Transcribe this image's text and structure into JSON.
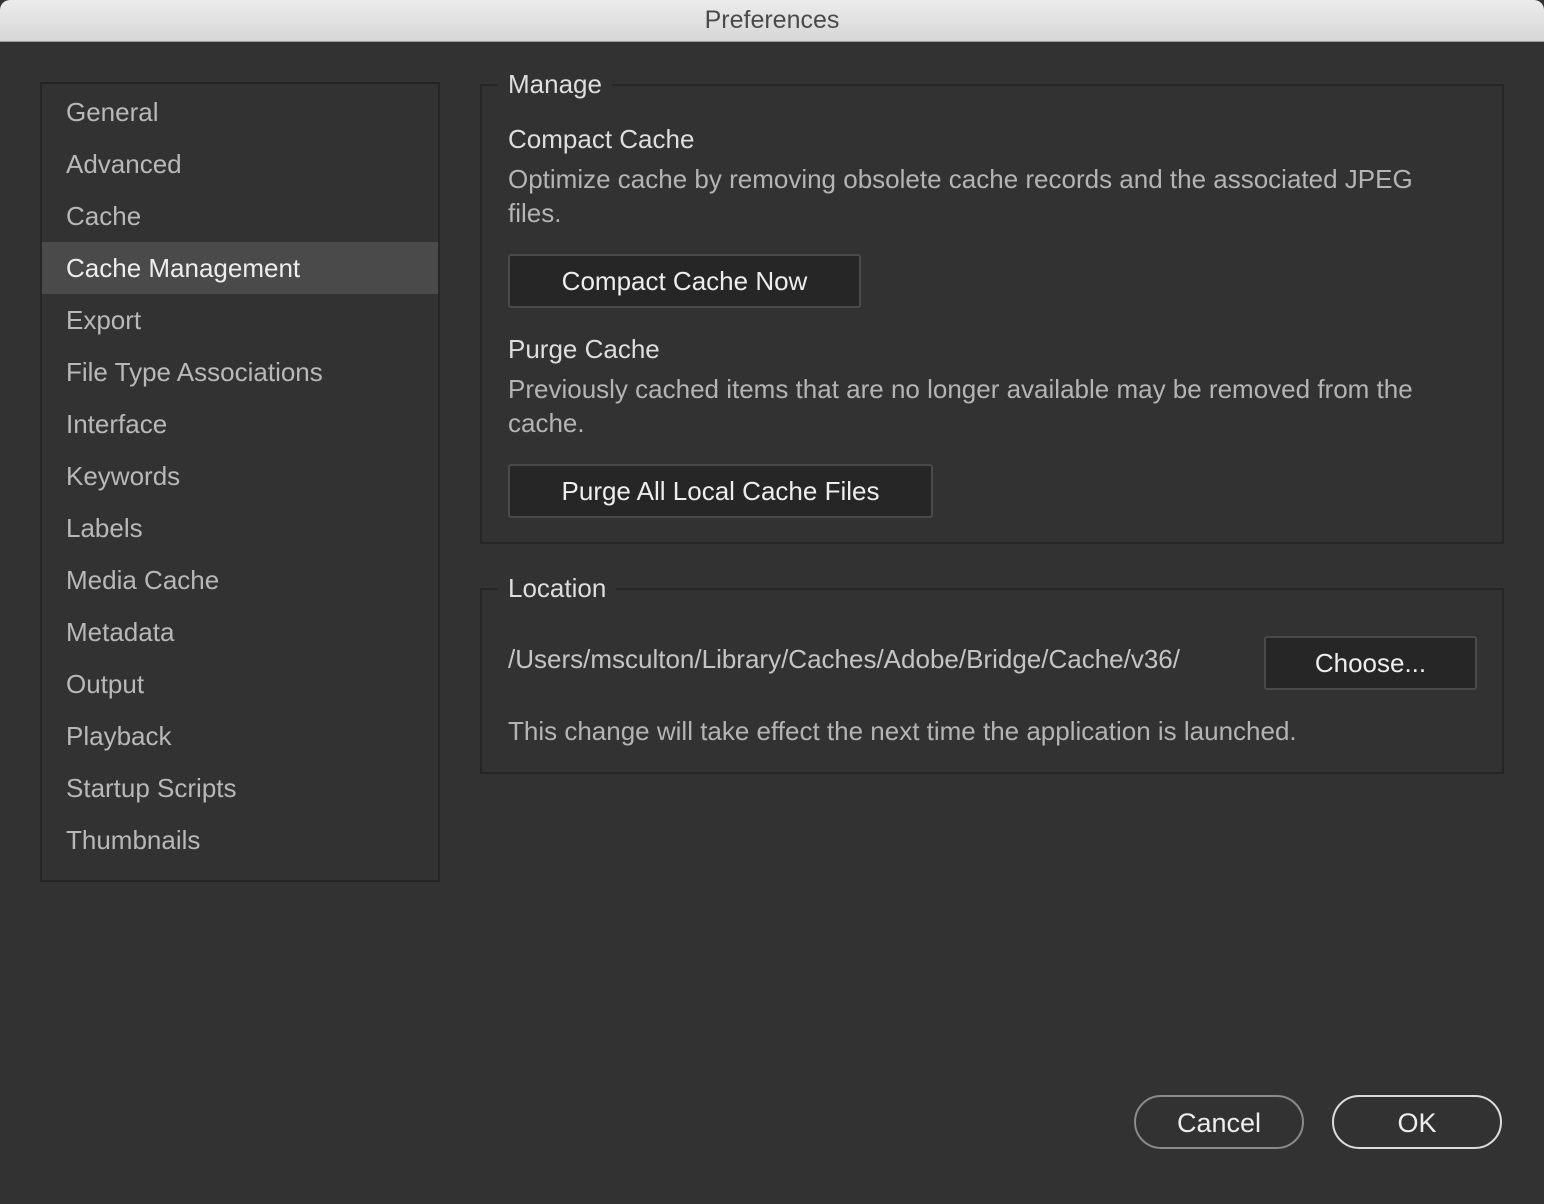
{
  "window": {
    "title": "Preferences"
  },
  "sidebar": {
    "items": [
      {
        "label": "General"
      },
      {
        "label": "Advanced"
      },
      {
        "label": "Cache"
      },
      {
        "label": "Cache Management"
      },
      {
        "label": "Export"
      },
      {
        "label": "File Type Associations"
      },
      {
        "label": "Interface"
      },
      {
        "label": "Keywords"
      },
      {
        "label": "Labels"
      },
      {
        "label": "Media Cache"
      },
      {
        "label": "Metadata"
      },
      {
        "label": "Output"
      },
      {
        "label": "Playback"
      },
      {
        "label": "Startup Scripts"
      },
      {
        "label": "Thumbnails"
      }
    ],
    "selected_index": 3
  },
  "manage": {
    "legend": "Manage",
    "compact": {
      "heading": "Compact Cache",
      "description": "Optimize cache by removing obsolete cache records and the associated JPEG files.",
      "button_label": "Compact Cache Now"
    },
    "purge": {
      "heading": "Purge Cache",
      "description": "Previously cached items that are no longer available may be removed from the cache.",
      "button_label": "Purge All Local Cache Files"
    }
  },
  "location": {
    "legend": "Location",
    "path": "/Users/msculton/Library/Caches/Adobe/Bridge/Cache/v36/",
    "choose_label": "Choose...",
    "note": "This change will take effect the next time the application is launched."
  },
  "footer": {
    "cancel_label": "Cancel",
    "ok_label": "OK"
  },
  "colors": {
    "background": "#323232",
    "selected_item": "#4a4a4a",
    "titlebar": "#e0e0e0"
  }
}
